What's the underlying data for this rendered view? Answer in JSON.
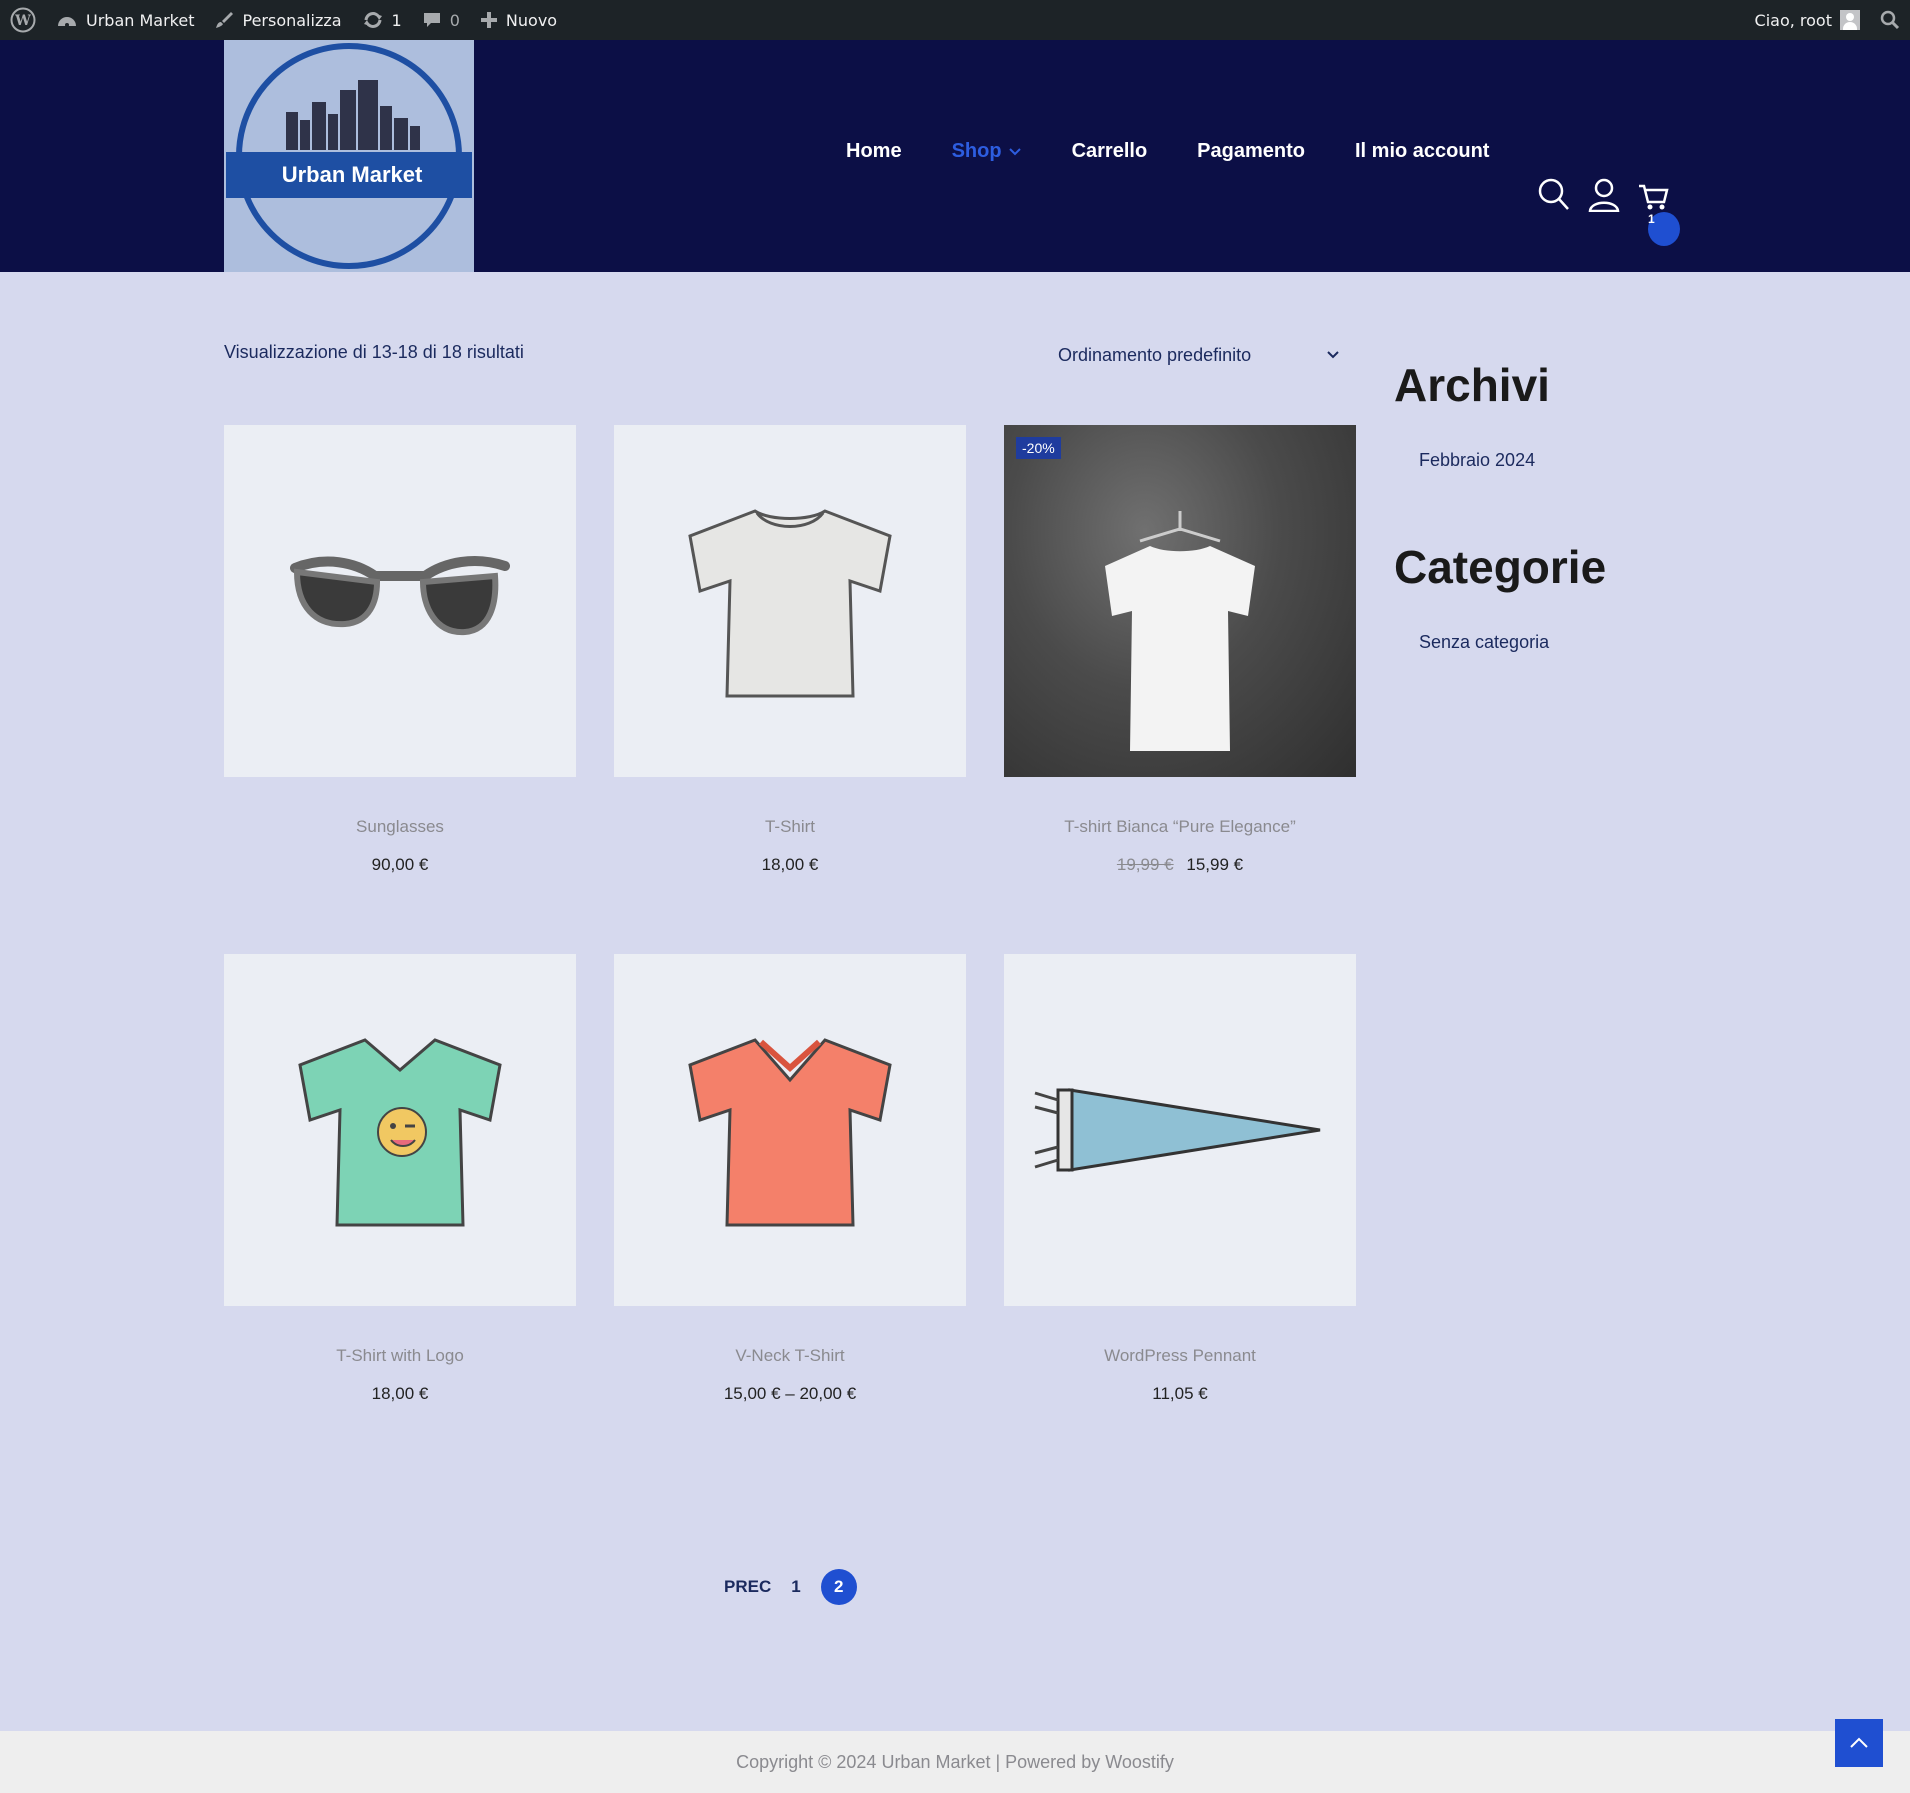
{
  "adminbar": {
    "site_name": "Urban Market",
    "customize": "Personalizza",
    "updates_count": "1",
    "comments_count": "0",
    "new_label": "Nuovo",
    "greeting": "Ciao, root"
  },
  "header": {
    "logo_text": "Urban Market",
    "nav": [
      {
        "label": "Home"
      },
      {
        "label": "Shop"
      },
      {
        "label": "Carrello"
      },
      {
        "label": "Pagamento"
      },
      {
        "label": "Il mio account"
      }
    ],
    "cart_count": "1"
  },
  "shop": {
    "result_count": "Visualizzazione di 13-18 di 18 risultati",
    "ordering": "Ordinamento predefinito",
    "products": [
      {
        "name": "Sunglasses",
        "price": "90,00 €"
      },
      {
        "name": "T-Shirt",
        "price": "18,00 €"
      },
      {
        "name": "T-shirt Bianca “Pure Elegance”",
        "old_price": "19,99 €",
        "price": "15,99 €",
        "badge": "-20%"
      },
      {
        "name": "T-Shirt with Logo",
        "price": "18,00 €"
      },
      {
        "name": "V-Neck T-Shirt",
        "price": "15,00 € – 20,00 €"
      },
      {
        "name": "WordPress Pennant",
        "price": "11,05 €"
      }
    ]
  },
  "sidebar": {
    "archives_title": "Archivi",
    "archives": [
      "Febbraio 2024"
    ],
    "categories_title": "Categorie",
    "categories": [
      "Senza categoria"
    ]
  },
  "pagination": {
    "prev": "PREC",
    "pages": [
      "1",
      "2"
    ]
  },
  "footer": {
    "copyright": "Copyright © 2024 Urban Market | Powered by Woostify"
  },
  "colors": {
    "header_bg": "#0c0f46",
    "accent": "#1f4fd1",
    "page_bg": "#d6d9ee"
  }
}
